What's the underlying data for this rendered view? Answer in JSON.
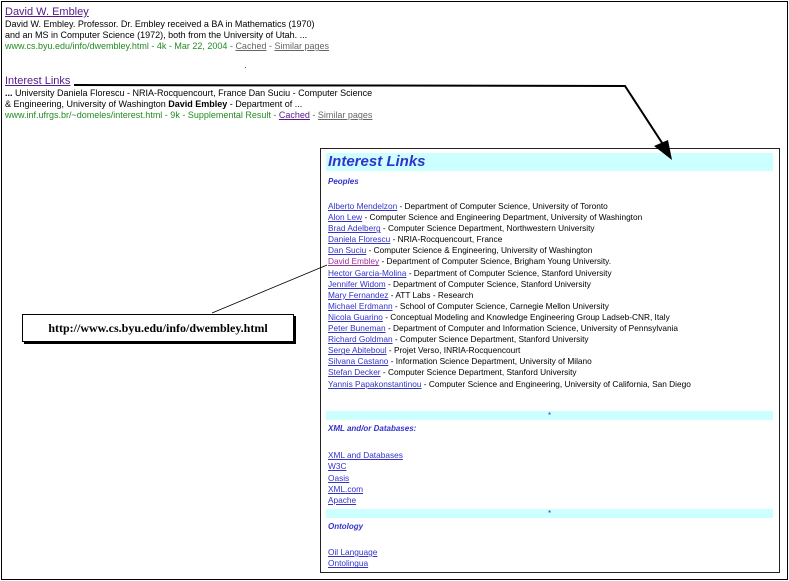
{
  "results": [
    {
      "title": "David W. Embley",
      "snippet_lines": [
        "David W. Embley. Professor. Dr. Embley received a BA in Mathematics (1970)",
        "and an MS in Computer Science (1972), both from the University of Utah. ..."
      ],
      "url_meta": "www.cs.byu.edu/info/dwembley.html - 4k - Mar 22, 2004",
      "cached": "Cached",
      "similar": "Similar pages"
    },
    {
      "title": "Interest Links",
      "snippet_line1": "... University Daniela Florescu - NRIA-Rocquencourt, France Dan Suciu - Computer Science",
      "snippet_line2_pre": "& Engineering, University of Washington ",
      "snippet_line2_bold": "David Embley",
      "snippet_line2_post": " - Department of ...",
      "url_meta": "www.inf.ufrgs.br/~domeles/interest.html - 9k - Supplemental Result",
      "cached": "Cached",
      "similar": "Similar pages"
    }
  ],
  "separator": " - ",
  "panel": {
    "title": "Interest Links",
    "people_heading": "Peoples",
    "people": [
      {
        "name": "Alberto Mendelzon",
        "desc": " - Department of Computer Science, University of Toronto"
      },
      {
        "name": "Alon Lew",
        "desc": " -  Computer Science and Engineering Department, University of Washington"
      },
      {
        "name": "Brad Adelberg",
        "desc": " -  Computer Science Department, Northwestern University"
      },
      {
        "name": "Daniela Florescu",
        "desc": " -  NRIA-Rocquencourt, France"
      },
      {
        "name": "Dan Suciu",
        "desc": " -  Computer Science & Engineering, University of Washington"
      },
      {
        "name": "David Embley",
        "desc": " -  Department of Computer Science, Brigham Young University."
      },
      {
        "name": "Hector Garcia-Molina",
        "desc": " -  Department of Computer Science, Stanford University"
      },
      {
        "name": "Jennifer Widom",
        "desc": " -  Department of Computer Science, Stanford University"
      },
      {
        "name": "Mary Fernandez",
        "desc": " - ATT Labs - Research"
      },
      {
        "name": "Michael Erdmann",
        "desc": " -  School of Computer Science, Carnegie Mellon University"
      },
      {
        "name": "Nicola Guarino",
        "desc": " -  Conceptual Modeling and Knowledge Engineering Group Ladseb-CNR, Italy"
      },
      {
        "name": "Peter Buneman",
        "desc": " -  Department of Computer and Information Science, University of Pennsylvania"
      },
      {
        "name": "Richard Goldman",
        "desc": " -  Computer Science Department, Stanford University"
      },
      {
        "name": "Serge Abiteboul",
        "desc": " -  Projet Verso, INRIA-Rocquencourt"
      },
      {
        "name": "Silvana Castano",
        "desc": " - Information Science Department, University of Milano"
      },
      {
        "name": "Stefan Decker",
        "desc": " -  Computer Science Department, Stanford University"
      },
      {
        "name": "Yannis Papakonstantinou",
        "desc": " -  Computer Science and Engineering, University of California, San Diego"
      }
    ],
    "star": "*",
    "xml_heading": "XML and/or Databases:",
    "xml_links": [
      "XML and Databases",
      "W3C",
      "Oasis",
      "XML.com",
      "Apache"
    ],
    "ontology_heading": "Ontology",
    "ontology_links": [
      "Oil Language",
      "Ontolingua"
    ]
  },
  "callout_text": "http://www.cs.byu.edu/info/dwembley.html"
}
